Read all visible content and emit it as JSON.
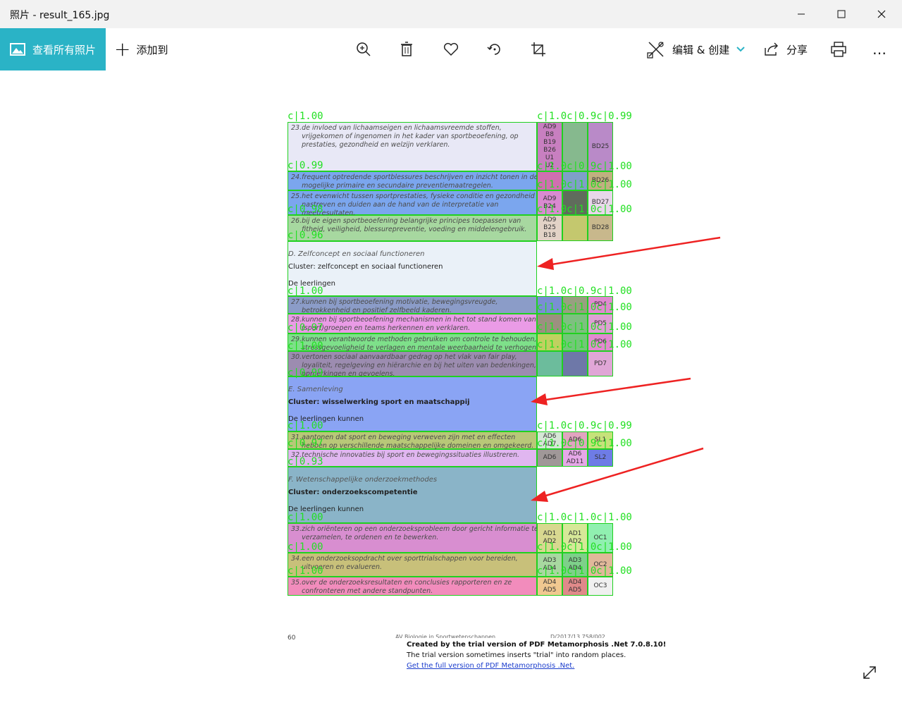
{
  "window": {
    "title": "照片 - result_165.jpg",
    "minimize": "—",
    "maximize": "☐",
    "close": "✕"
  },
  "toolbar": {
    "view_all_label": "查看所有照片",
    "add_to_label": "添加到",
    "edit_create_label": "编辑 & 创建",
    "share_label": "分享",
    "more_label": "…",
    "icons": [
      "zoom-in-icon",
      "delete-icon",
      "heart-icon",
      "rotate-icon",
      "crop-icon",
      "edit-create-icon",
      "share-icon",
      "print-icon"
    ]
  },
  "document": {
    "confidence_labels": {
      "c_100": "c|1.00",
      "c_099": "c|0.99",
      "c_098": "c|0.98",
      "c_097": "c|0.97",
      "c_093": "c|0.93",
      "c_096": "c|0.96",
      "c_row1": "c|1.0c|0.9c|0.99",
      "c_row2": "c|1.0c|0.9c|1.00",
      "c_row3": "c|1.0c|1.0c|1.00",
      "c_row4": "c|1.0c|1.0c|1.00"
    },
    "rows": [
      {
        "text": "23.de invloed van lichaamseigen en lichaamsvreemde stoffen,\n     vrijgekomen of ingenomen in het kader van sportbeoefening, op\n     prestaties, gezondheid en welzijn verklaren.",
        "c1": "AD9\nB8\nB19\nB26\nU1\nU2",
        "c3": "BD25"
      },
      {
        "text": "24.frequent optredende sportblessures beschrijven en inzicht tonen in de\n     mogelijke primaire en secundaire preventiemaatregelen.",
        "c1": "",
        "c3": "BD26"
      },
      {
        "text": "25.het evenwicht tussen sportprestaties, fysieke conditie en gezondheid\n     nastreven en duiden aan de hand van de interpretatie van\n     meetresultaten.",
        "c1": "AD9\nB24",
        "c3": "BD27"
      },
      {
        "text": "26.bij de eigen sportbeoefening belangrijke principes toepassen van\n     fitheid, veiligheid, blessurepreventie, voeding en middelengebruik.",
        "c1": "AD9\nB25\nB18",
        "c3": "BD28"
      },
      {
        "text": "27.kunnen bij sportbeoefening motivatie, bewegingsvreugde,\n     betrokkenheid en positief zelfbeeld kaderen.",
        "c1": "",
        "c3": "PD4"
      },
      {
        "text": "28.kunnen bij sportbeoefening mechanismen in het tot stand komen van\n     (sport)groepen en teams herkennen en verklaren.",
        "c1": "",
        "c3": "PD5"
      },
      {
        "text": "29.kunnen verantwoorde methoden gebruiken om controle te behouden,\n     stressgevoeligheid te verlagen en mentale weerbaarheid te verhogen.",
        "c1": "",
        "c3": "PD6"
      },
      {
        "text": "30.vertonen sociaal aanvaardbaar gedrag op het vlak van fair play,\n     loyaliteit, regelgeving en hiërarchie en bij het uiten van bedenkingen,\n     opmerkingen en gevoelens.",
        "c1": "",
        "c3": "PD7"
      },
      {
        "text": "31.aantonen dat sport en beweging verweven zijn met en effecten\n     hebben op verschillende maatschappelijke domeinen en omgekeerd.",
        "c1": "AD6\nAD7",
        "c2": "AD6",
        "c3": "SL1"
      },
      {
        "text": "32.technische innovaties bij sport en bewegingssituaties illustreren.",
        "c1": "AD6",
        "c2": "AD6\nAD11",
        "c3": "SL2"
      },
      {
        "text": "33.zich oriënteren op een onderzoeksprobleem door gericht informatie te\n     verzamelen, te ordenen en te bewerken.",
        "c1": "AD1\nAD2",
        "c2": "AD1\nAD2",
        "c3": "OC1"
      },
      {
        "text": "34.een onderzoeksopdracht over sporttrialschappen voor bereiden,\n     uitvoeren en evalueren.",
        "c1": "AD3\nAD4",
        "c2": "AD3\nAD4",
        "c3": "OC2"
      },
      {
        "text": "35.over de onderzoeksresultaten en conclusies rapporteren en ze\n     confronteren met andere standpunten.",
        "c1": "AD4\nAD5",
        "c2": "AD4\nAD5",
        "c3": "OC3"
      }
    ],
    "sections": [
      {
        "heading": "D. Zelfconcept en sociaal functioneren",
        "cluster": "Cluster: zelfconcept en sociaal functioneren",
        "sub": "De leerlingen"
      },
      {
        "heading": "E. Samenleving",
        "cluster": "Cluster: wisselwerking sport en maatschappij",
        "sub": "De leerlingen kunnen"
      },
      {
        "heading": "F. Wetenschappelijke onderzoekmethodes",
        "cluster": "Cluster: onderzoekscompetentie",
        "sub": "De leerlingen kunnen"
      }
    ],
    "footer": {
      "page_number": "60",
      "course": "AV Biologie in Sportwetenschappen",
      "code": "D/2017/13.758/002",
      "trial_line1": "Created by the trial version of PDF Metamorphosis .Net 7.0.8.10!",
      "trial_line2": "The trial version sometimes inserts \"trial\" into random places.",
      "trial_link": "Get the full version of PDF Metamorphosis .Net."
    }
  },
  "fullscreen_icon": "expand-icon"
}
